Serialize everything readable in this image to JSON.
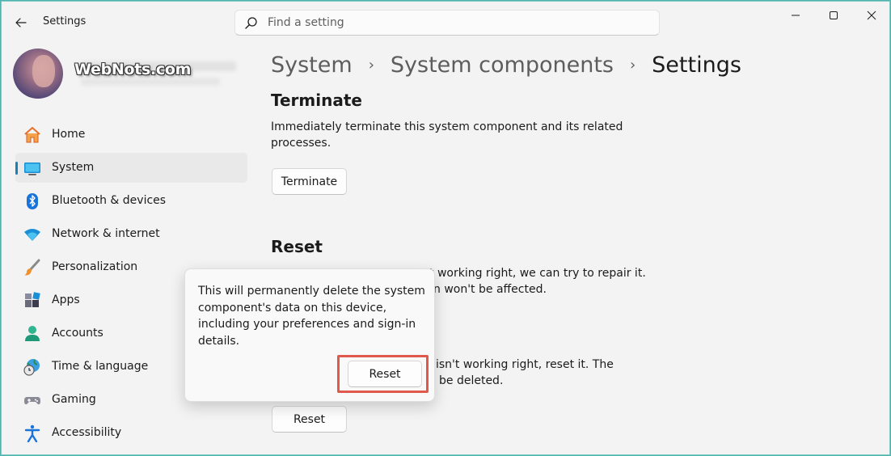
{
  "window": {
    "app_title": "Settings"
  },
  "search": {
    "placeholder": "Find a setting"
  },
  "watermark": "WebNots.com",
  "sidebar": {
    "items": [
      {
        "label": "Home",
        "icon": "home-icon",
        "selected": false
      },
      {
        "label": "System",
        "icon": "system-icon",
        "selected": true
      },
      {
        "label": "Bluetooth & devices",
        "icon": "bluetooth-icon",
        "selected": false
      },
      {
        "label": "Network & internet",
        "icon": "wifi-icon",
        "selected": false
      },
      {
        "label": "Personalization",
        "icon": "brush-icon",
        "selected": false
      },
      {
        "label": "Apps",
        "icon": "apps-icon",
        "selected": false
      },
      {
        "label": "Accounts",
        "icon": "account-icon",
        "selected": false
      },
      {
        "label": "Time & language",
        "icon": "globe-clock-icon",
        "selected": false
      },
      {
        "label": "Gaming",
        "icon": "gamepad-icon",
        "selected": false
      },
      {
        "label": "Accessibility",
        "icon": "accessibility-icon",
        "selected": false
      }
    ]
  },
  "breadcrumb": {
    "items": [
      "System",
      "System components",
      "Settings"
    ],
    "separator": "›"
  },
  "terminate": {
    "title": "Terminate",
    "description_line1": "Immediately terminate this system component and its related",
    "description_line2": "processes.",
    "button_label": "Terminate"
  },
  "reset": {
    "title": "Reset",
    "repair_desc_line1_visible": "t working right, we can try to repair it.",
    "repair_desc_line2_visible": "n won't be affected.",
    "reset_desc_line1_visible": "isn't working right, reset it. The",
    "reset_desc_line2_visible": "be deleted.",
    "button_label": "Reset"
  },
  "flyout": {
    "message": "This will permanently delete the system component's data on this device, including your preferences and sign-in details.",
    "confirm_label": "Reset"
  },
  "colors": {
    "accent": "#1b7fb8",
    "highlight_box": "#e0594d"
  }
}
